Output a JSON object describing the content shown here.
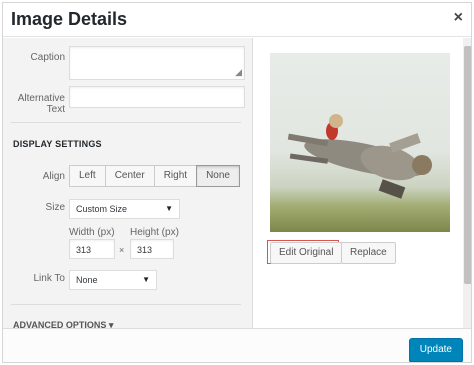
{
  "header": {
    "title": "Image Details",
    "close_glyph": "×"
  },
  "left": {
    "caption_label": "Caption",
    "caption_value": "",
    "alt_label_line1": "Alternative",
    "alt_label_line2": "Text",
    "alt_value": "",
    "display_settings_title": "DISPLAY SETTINGS",
    "align_label": "Align",
    "align_options": [
      "Left",
      "Center",
      "Right",
      "None"
    ],
    "align_selected": "None",
    "size_label": "Size",
    "size_value": "Custom Size",
    "width_label": "Width (px)",
    "height_label": "Height (px)",
    "width_value": "313",
    "height_value": "313",
    "times_glyph": "×",
    "link_label": "Link To",
    "link_value": "None",
    "advanced_title": "ADVANCED OPTIONS ▾"
  },
  "right": {
    "edit_original_label": "Edit Original",
    "replace_label": "Replace"
  },
  "footer": {
    "update_label": "Update"
  },
  "icons": {
    "close": "close-icon",
    "dropdown": "chevron-down-icon"
  },
  "colors": {
    "primary": "#0085ba",
    "highlight_border": "#d9534f"
  }
}
